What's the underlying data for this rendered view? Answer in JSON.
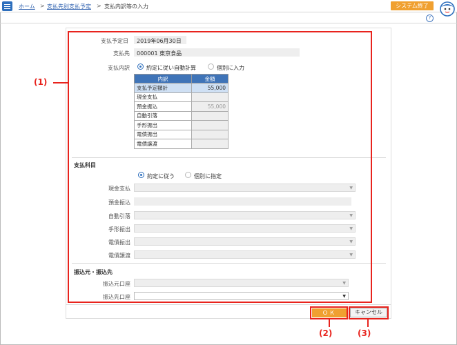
{
  "header": {
    "breadcrumb_home": "ホーム",
    "breadcrumb_sep1": ">",
    "breadcrumb_parent": "支払先別支払予定",
    "breadcrumb_sep2": ">",
    "breadcrumb_current": "支払内訳等の入力",
    "system_end_label": "システム終了",
    "help_glyph": "?"
  },
  "form": {
    "due_date_label": "支払予定日",
    "due_date_value": "2019年06月30日",
    "payee_label": "支払先",
    "payee_value": "000001 東京食品",
    "breakdown_label": "支払内訳",
    "breakdown_option_auto": "約定に従い自動計算",
    "breakdown_option_manual": "個別に入力"
  },
  "breakdown_table": {
    "headers": [
      "内訳",
      "金額"
    ],
    "rows": [
      {
        "label": "支払予定額計",
        "amount": "55,000"
      },
      {
        "label": "現金支払",
        "amount": ""
      },
      {
        "label": "預金振込",
        "amount": "55,000"
      },
      {
        "label": "自動引落",
        "amount": ""
      },
      {
        "label": "手形振出",
        "amount": ""
      },
      {
        "label": "電債振出",
        "amount": ""
      },
      {
        "label": "電債譲渡",
        "amount": ""
      }
    ]
  },
  "accounts": {
    "section_title": "支払科目",
    "option_contract": "約定に従う",
    "option_individual": "個別に指定",
    "cash_label": "現金支払",
    "deposit_label": "預金振込",
    "auto_debit_label": "自動引落",
    "bill_label": "手形振出",
    "ebond_issue_label": "電債振出",
    "ebond_transfer_label": "電債譲渡"
  },
  "transfer": {
    "section_title": "振込元・振込先",
    "source_label": "振込元口座",
    "dest_label": "振込先口座"
  },
  "buttons": {
    "ok_label": "ＯＫ",
    "cancel_label": "キャンセル"
  },
  "callouts": {
    "c1": "(1)",
    "c2": "(2)",
    "c3": "(3)"
  },
  "colors": {
    "accent_blue": "#2e6fbd",
    "orange": "#f0a030",
    "annotation_red": "#e8231d"
  }
}
